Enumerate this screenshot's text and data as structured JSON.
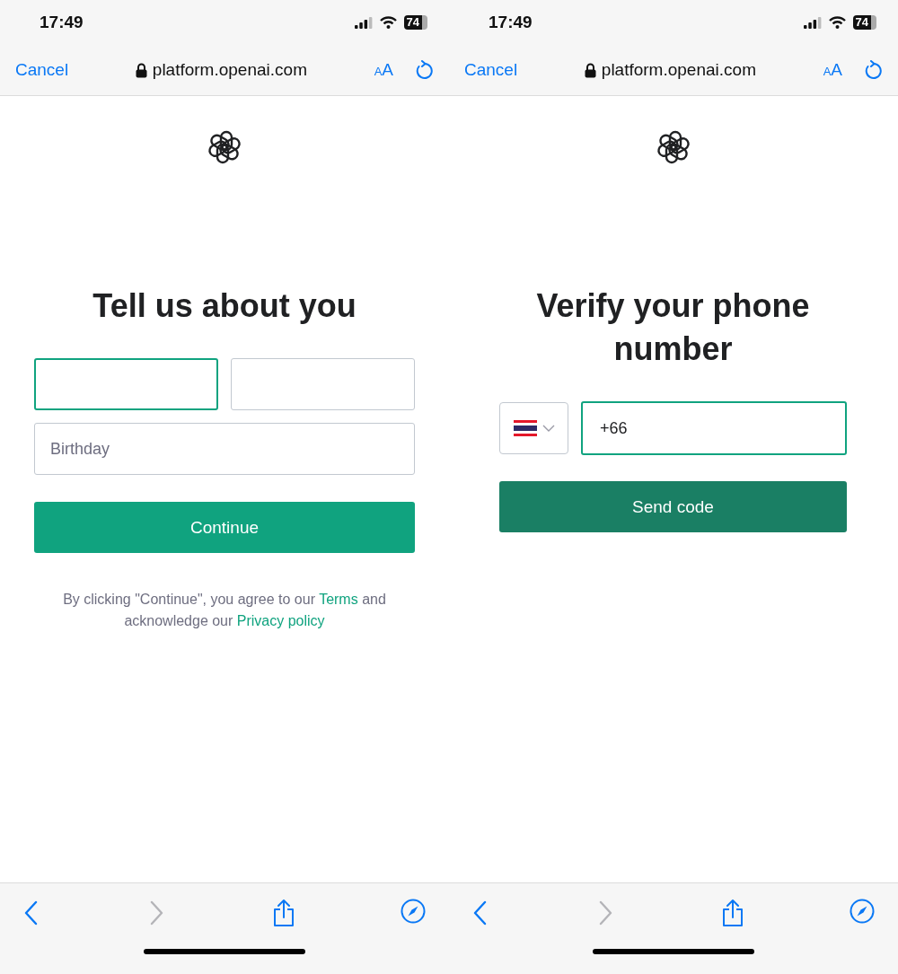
{
  "screens": [
    {
      "kind": "details",
      "status_bar": {
        "time": "17:49",
        "battery": "74"
      },
      "browser": {
        "cancel": "Cancel",
        "url": "platform.openai.com",
        "text_size": "AA"
      },
      "heading": "Tell us about you",
      "fields": [
        {
          "kind": "first-name",
          "focused": true
        },
        {
          "kind": "last-name",
          "focused": false
        },
        {
          "kind": "birthday",
          "placeholder": "Birthday",
          "focused": false
        }
      ],
      "button": "Continue",
      "legal": [
        {
          "kind": "plain",
          "text": "By clicking \"Continue\", you agree to our "
        },
        {
          "kind": "link",
          "text": "Terms"
        },
        {
          "kind": "plain",
          "text": " and acknowledge our "
        },
        {
          "kind": "link",
          "text": "Privacy policy"
        }
      ],
      "toolbar": [
        {
          "kind": "back",
          "disabled": false
        },
        {
          "kind": "forward",
          "disabled": true
        },
        {
          "kind": "share",
          "disabled": false
        },
        {
          "kind": "compass",
          "disabled": false
        }
      ]
    },
    {
      "kind": "phone",
      "status_bar": {
        "time": "17:49",
        "battery": "74"
      },
      "browser": {
        "cancel": "Cancel",
        "url": "platform.openai.com",
        "text_size": "AA"
      },
      "heading": "Verify your phone number",
      "fields": [
        {
          "kind": "country",
          "focused": false
        },
        {
          "kind": "phone",
          "value": "+66",
          "focused": true
        }
      ],
      "button": "Send code",
      "toolbar": [
        {
          "kind": "back",
          "disabled": false
        },
        {
          "kind": "forward",
          "disabled": true
        },
        {
          "kind": "share",
          "disabled": false
        },
        {
          "kind": "compass",
          "disabled": false
        }
      ]
    }
  ]
}
